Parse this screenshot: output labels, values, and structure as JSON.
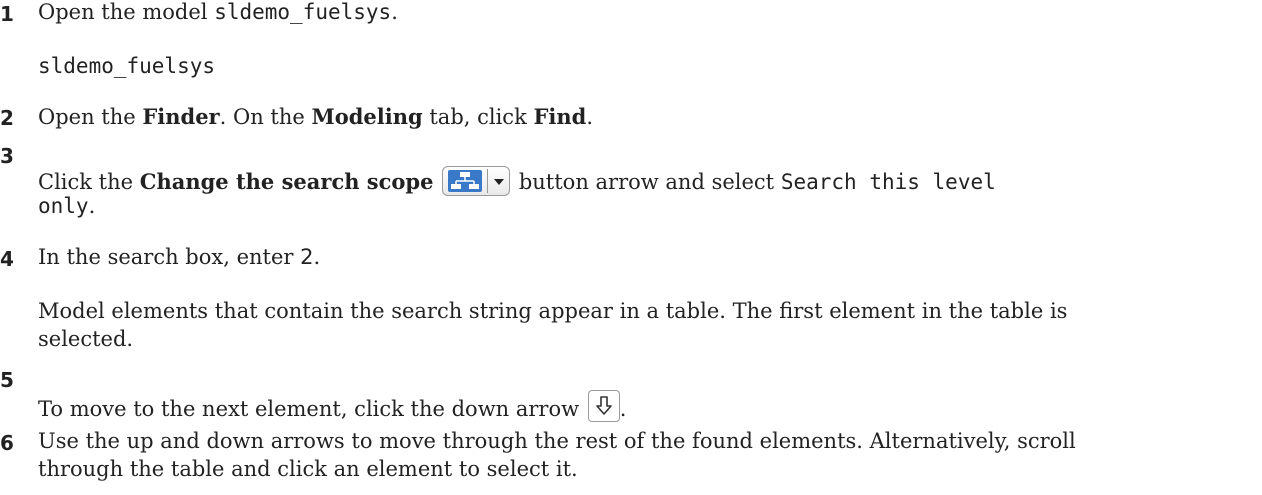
{
  "steps": [
    {
      "number": "1",
      "pre": "Open the model ",
      "code": "sldemo_fuelsys",
      "post": ".",
      "code_block": "sldemo_fuelsys"
    },
    {
      "number": "2",
      "t1": "Open the ",
      "b1": "Finder",
      "t2": ". On the ",
      "b2": "Modeling",
      "t3": " tab, click ",
      "b3": "Find",
      "t4": "."
    },
    {
      "number": "3",
      "t1": "Click the ",
      "b1": "Change the search scope",
      "t2": " button arrow and select ",
      "code_a": "Search this level",
      "code_b": "only",
      "t3": "."
    },
    {
      "number": "4",
      "t1": "In the search box, enter ",
      "value": "2",
      "t2": ".",
      "para_line1": "Model elements that contain the search string appear in a table. The first element in the table is",
      "para_line2": "selected."
    },
    {
      "number": "5",
      "t1": "To move to the next element, click the down arrow ",
      "t2": "."
    },
    {
      "number": "6",
      "line1": "Use the up and down arrows to move through the rest of the found elements. Alternatively, scroll",
      "line2": "through the table and click an element to select it."
    }
  ],
  "icons": {
    "search_scope_button": "search-scope-icon",
    "dropdown_arrow": "chevron-down-icon",
    "down_arrow_button": "arrow-down-icon"
  }
}
